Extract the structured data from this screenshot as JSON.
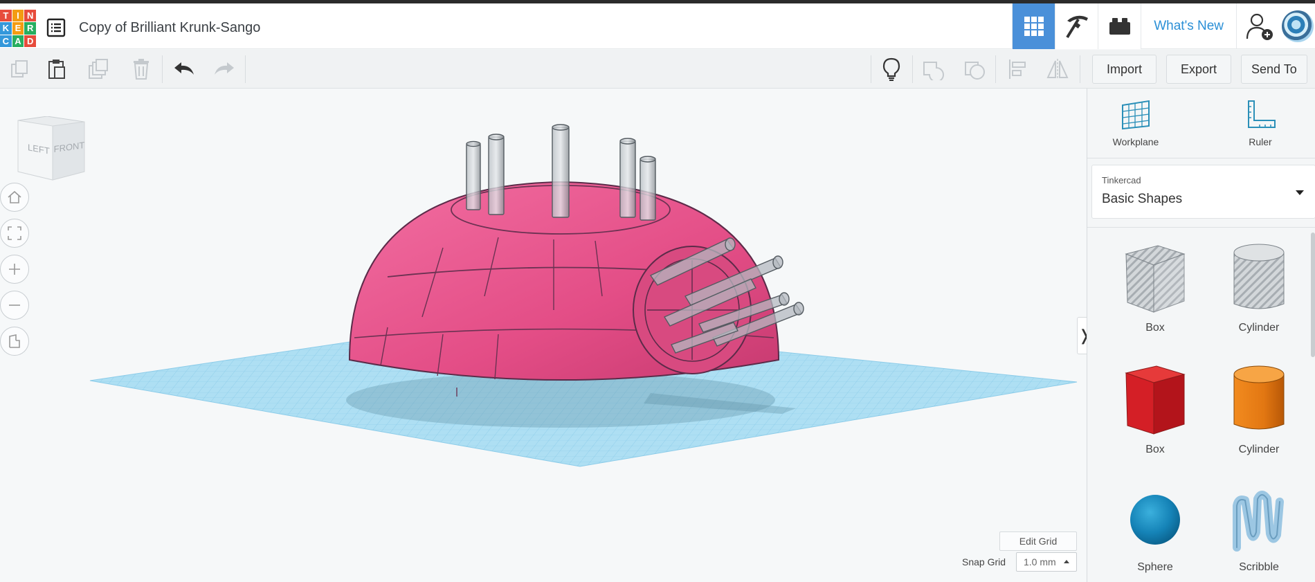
{
  "app": {
    "logo_letters": [
      "T",
      "I",
      "N",
      "K",
      "E",
      "R",
      "C",
      "A",
      "D"
    ],
    "logo_colors": [
      "#e74c3c",
      "#f39c12",
      "#e74c3c",
      "#3498db",
      "#f39c12",
      "#27ae60",
      "#3498db",
      "#27ae60",
      "#e74c3c"
    ],
    "document_title": "Copy of Brilliant Krunk-Sango"
  },
  "header": {
    "whats_new": "What's New",
    "accent_color": "#4a90d9"
  },
  "toolbar": {
    "import": "Import",
    "export": "Export",
    "send_to": "Send To"
  },
  "viewcube": {
    "left_face": "LEFT",
    "front_face": "FRONT"
  },
  "workplane_controls": {
    "edit_grid": "Edit Grid",
    "snap_grid_label": "Snap Grid",
    "snap_grid_value": "1.0 mm"
  },
  "panel": {
    "workplane": "Workplane",
    "ruler": "Ruler",
    "library_category": "Tinkercad",
    "library_value": "Basic Shapes",
    "shapes": [
      {
        "label": "Box",
        "kind": "box-hole"
      },
      {
        "label": "Cylinder",
        "kind": "cyl-hole"
      },
      {
        "label": "Box",
        "kind": "box-red"
      },
      {
        "label": "Cylinder",
        "kind": "cyl-orange"
      },
      {
        "label": "Sphere",
        "kind": "sphere-blue"
      },
      {
        "label": "Scribble",
        "kind": "scribble"
      }
    ]
  }
}
